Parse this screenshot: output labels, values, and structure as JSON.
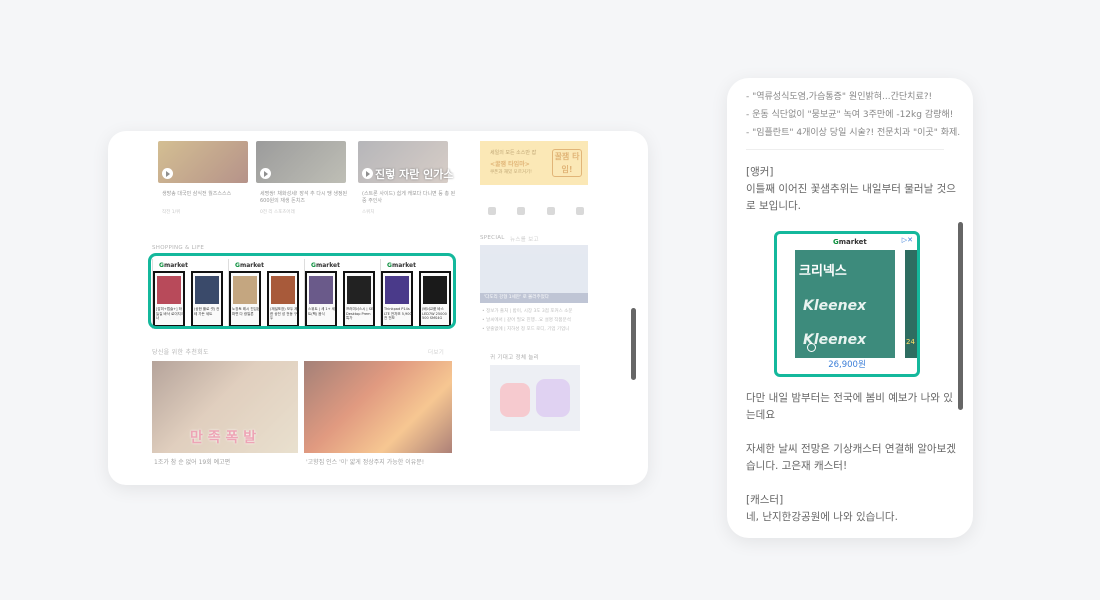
{
  "left_card": {
    "videos": [
      {
        "thumb_text": "",
        "title": "생방송 대국민 삼식전 월즈스스스",
        "source": "작전 1/위"
      },
      {
        "thumb_text": "",
        "title": "세명쌍! 채화성세! 장석 추 다시 땡 생정된 600원의 재생 돈치즈",
        "source": "0전 리 스포츠어래"
      },
      {
        "thumb_text": "진렇 자란 인가스",
        "title": "(스트론 사이드) 쉽게 캐보다 다니면 등 총 된 중 주인사",
        "source": "스위치"
      }
    ],
    "ad_banner": {
      "line1": "세일의 모든 소스만 잡",
      "line2": "<꿀잼 타임마>",
      "line3": "쿠폰과 재밌 모르거기!",
      "logo": "꿀잼 타임!"
    },
    "shopping_label": "SHOPPING & LIFE",
    "gmarket": {
      "logo_g": "G",
      "logo_rest": "market",
      "products": [
        "[감미+캡슐+] 하늘길 바삭 로이지크너",
        "(상한 플로 셋) 컨테 가든 세트",
        "노장토 레시 진입된 파편 다 광일론",
        "(재설포장) 모두 제한 상전 성 전동 구두",
        "스위트 | 세 1+ 세트(팩) 음식",
        "프러미너스시 | SE Desktop Prem 특가",
        "Thinkpad P14s LTE 전자모 5,900 전 전모",
        "(배너교품 바스 LED7W 25000 500 SMS4G"
      ]
    },
    "special_label": "SPECIAL",
    "special_sub": "뉴스를 보고",
    "special_caption": "'다도리 강형 1세만' 로 몰러주었다",
    "special_lines": [
      "• 정보가 출처 | 밤이, 시장 3도 3점 포커스 소문",
      "• 날씨에서 | 같어 필요 진행...요 설명 작품분석",
      "• 앞줄없에 | 지하성 정 포드 로디, 기업 기업니"
    ],
    "recommend_label": "당신을 위한 추천회도",
    "recommend_more": "더보기",
    "recommend_items": [
      {
        "overlay": "만 족 폭 발",
        "caption": "1조가 참 순 없어 19회 예고편"
      },
      {
        "overlay": "",
        "caption": "'고향집 인스 '이' 얇게 정상주지 가능한 이유문!"
      }
    ],
    "airpods_label": "귀 기대고 정체 늘리"
  },
  "right_card": {
    "news_items": [
      "- \"역류성식도염,가슴통증\" 원인밝혀...간단치료?!",
      "- 운동 식단없이 \"뭉보균\" 녹여 3주만에 -12kg 감량해!",
      "- \"임플란트\" 4개이상 당일 시술?! 전문치과 \"이곳\" 화제."
    ],
    "anchor_tag": "[앵커]",
    "anchor_text": "이틀째 이어진 꽃샘추위는 내일부터 물러날 것으로 보입니다.",
    "ad": {
      "logo_g": "G",
      "logo_rest": "market",
      "brand": "크리넥스",
      "kleenex": "Kleenex",
      "side_number": "24",
      "price": "26,900원",
      "choice": "▷✕"
    },
    "paragraph1": "다만 내일 밤부터는 전국에 봄비 예보가 나와 있는데요",
    "paragraph2": "자세한 날씨 전망은 기상캐스터 연결해 알아보겠습니다. 고은재 캐스터!",
    "caster_tag": "[캐스터]",
    "caster_text": "네, 난지한강공원에 나와 있습니다."
  },
  "colors": {
    "highlight": "#14b89c",
    "background": "#f5f6f8",
    "link_blue": "#3b7ed8"
  }
}
